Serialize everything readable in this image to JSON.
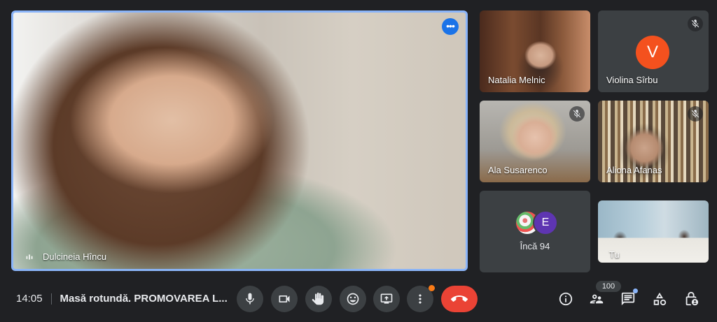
{
  "main_speaker": {
    "name": "Dulcineia Hîncu"
  },
  "tiles": [
    {
      "name": "Natalia Melnic"
    },
    {
      "name": "Violina Sîrbu",
      "initial": "V"
    },
    {
      "name": "Ala Susarenco"
    },
    {
      "name": "Aliona Afanas"
    },
    {
      "more_label": "Încă 94",
      "avatar_initial": "E"
    },
    {
      "name": "Tu"
    }
  ],
  "bottom_bar": {
    "time": "14:05",
    "meeting_title": "Masă rotundă. PROMOVAREA L..."
  },
  "participants_count": "100",
  "colors": {
    "accent": "#1a73e8",
    "hangup": "#ea4335",
    "avatar_v": "#f4511e",
    "avatar_e": "#5e35b1"
  }
}
